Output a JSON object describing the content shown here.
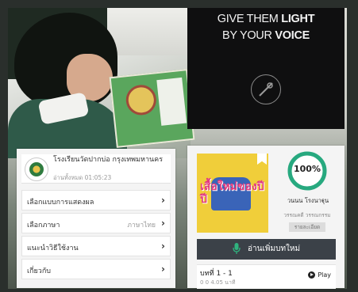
{
  "promo": {
    "line1_regular": "GIVE THEM ",
    "line1_bold": "LIGHT",
    "line2_regular": "BY YOUR ",
    "line2_bold": "VOICE",
    "icon": "microphone-icon"
  },
  "school": {
    "name": "โรงเรียนวัดปากบ่อ กรุงเทพมหานคร",
    "read_time": "อ่านทั้งหมด 01:05:23",
    "icon": "school-logo-icon"
  },
  "menu": {
    "items": [
      {
        "label": "เลือกแบบการแสดงผล",
        "value": ""
      },
      {
        "label": "เลือกภาษา",
        "value": "ภาษาไทย"
      },
      {
        "label": "แนะนำวิธีใช้งาน",
        "value": ""
      },
      {
        "label": "เกี่ยวกับ",
        "value": ""
      }
    ],
    "chevron": "›"
  },
  "book": {
    "cover_title": "เสื้อใหม่ของปีปี",
    "progress_text": "100%",
    "progress": 1.0,
    "progress_color": "#27a97f",
    "reader_name": "วนนน โรงนาฐุน",
    "reader_sub": "วรรณคดี วรรณกรรม",
    "detail_label": "รายละเอียด",
    "read_more_label": "อ่านเพิ่มบทใหม่",
    "read_more_icon_color": "#2fb37e"
  },
  "chapter": {
    "title": "บทที่ 1 - 1",
    "stats": "0      0      4.05 นาที",
    "play_label": "Play"
  }
}
